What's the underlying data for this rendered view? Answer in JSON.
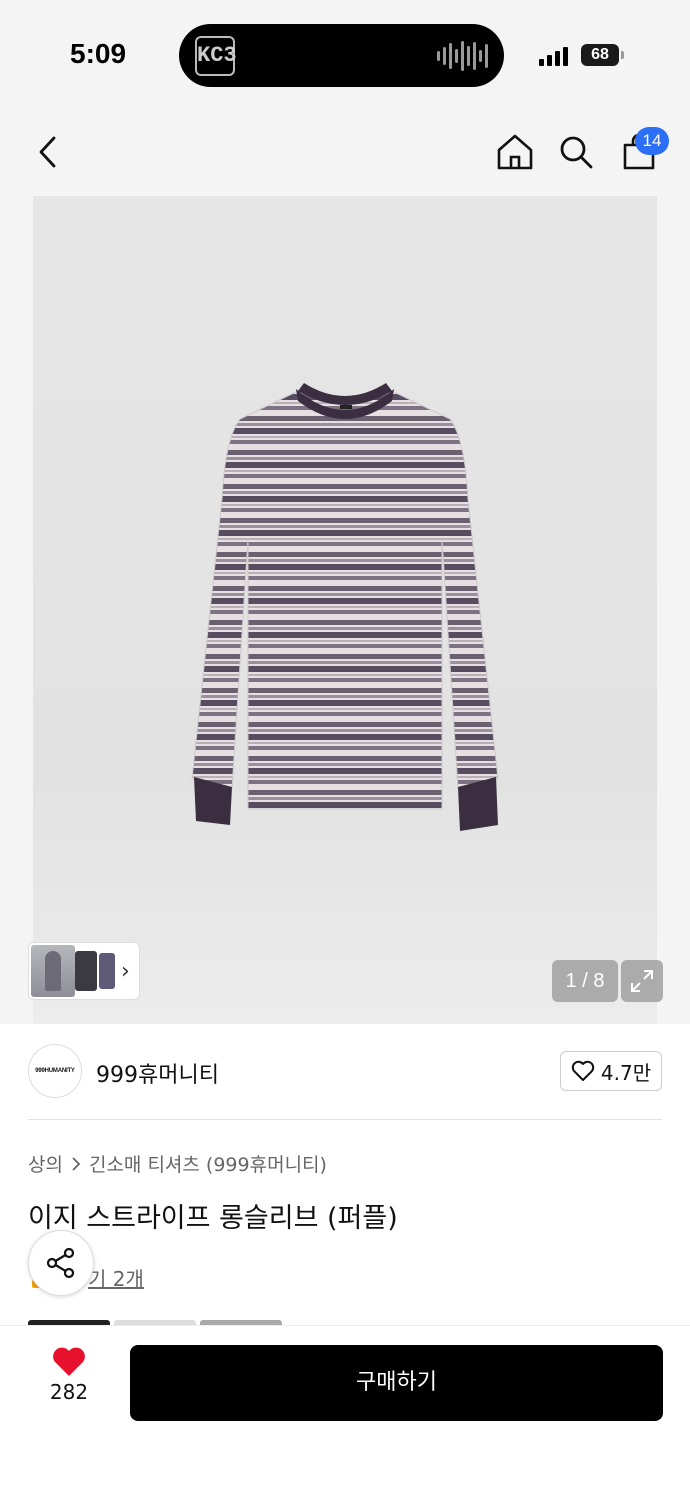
{
  "status_bar": {
    "time": "5:09",
    "island_logo": "KC3",
    "battery": "68"
  },
  "nav": {
    "cart_badge": "14"
  },
  "gallery": {
    "counter": "1 / 8",
    "current_index": 1,
    "total": 8
  },
  "brand": {
    "logo_text": "999HUMANITY",
    "name": "999휴머니티",
    "like_count": "4.7만"
  },
  "product": {
    "breadcrumb": [
      "상의",
      "긴소매 티셔츠 (999휴머니티)"
    ],
    "title": "이지 스트라이프 롱슬리브 (퍼플)",
    "review_link": "기 2개"
  },
  "bottom_bar": {
    "like_count": "282",
    "buy_label": "구매하기"
  },
  "colors": {
    "accent_badge": "#2b6ff6",
    "heart": "#e8112d",
    "buy_button": "#000000"
  }
}
